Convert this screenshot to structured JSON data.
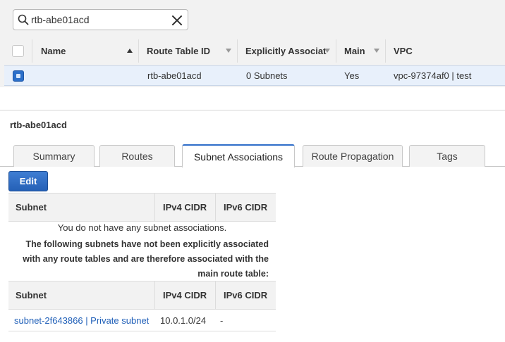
{
  "search": {
    "value": "rtb-abe01acd"
  },
  "grid": {
    "columns": [
      {
        "label": "Name"
      },
      {
        "label": "Route Table ID"
      },
      {
        "label": "Explicitly Associat"
      },
      {
        "label": "Main"
      },
      {
        "label": "VPC"
      }
    ],
    "rows": [
      {
        "name": "",
        "route_table_id": "rtb-abe01acd",
        "explicit_assoc": "0 Subnets",
        "main": "Yes",
        "vpc": "vpc-97374af0 | test",
        "selected": true
      }
    ]
  },
  "detail": {
    "title": "rtb-abe01acd",
    "tabs": [
      {
        "label": "Summary"
      },
      {
        "label": "Routes"
      },
      {
        "label": "Subnet Associations",
        "active": true
      },
      {
        "label": "Route Propagation"
      },
      {
        "label": "Tags"
      }
    ],
    "edit_label": "Edit",
    "table_headers": {
      "subnet": "Subnet",
      "ipv4": "IPv4 CIDR",
      "ipv6": "IPv6 CIDR"
    },
    "no_assoc_message": "You do not have any subnet associations.",
    "explain_lines": [
      "The following subnets have not been explicitly associated",
      "with any route tables and are therefore associated with the",
      "main route table:"
    ],
    "unassociated_subnets": [
      {
        "subnet": "subnet-2f643866 | Private subnet",
        "ipv4": "10.0.1.0/24",
        "ipv6": "-"
      }
    ]
  },
  "colors": {
    "accent": "#2f6ec9",
    "link": "#1f5fb8",
    "selected_row": "#e8f0fb"
  },
  "icons": {
    "search": "search-icon",
    "clear": "close-icon",
    "sort": "sort-arrow-icon"
  }
}
